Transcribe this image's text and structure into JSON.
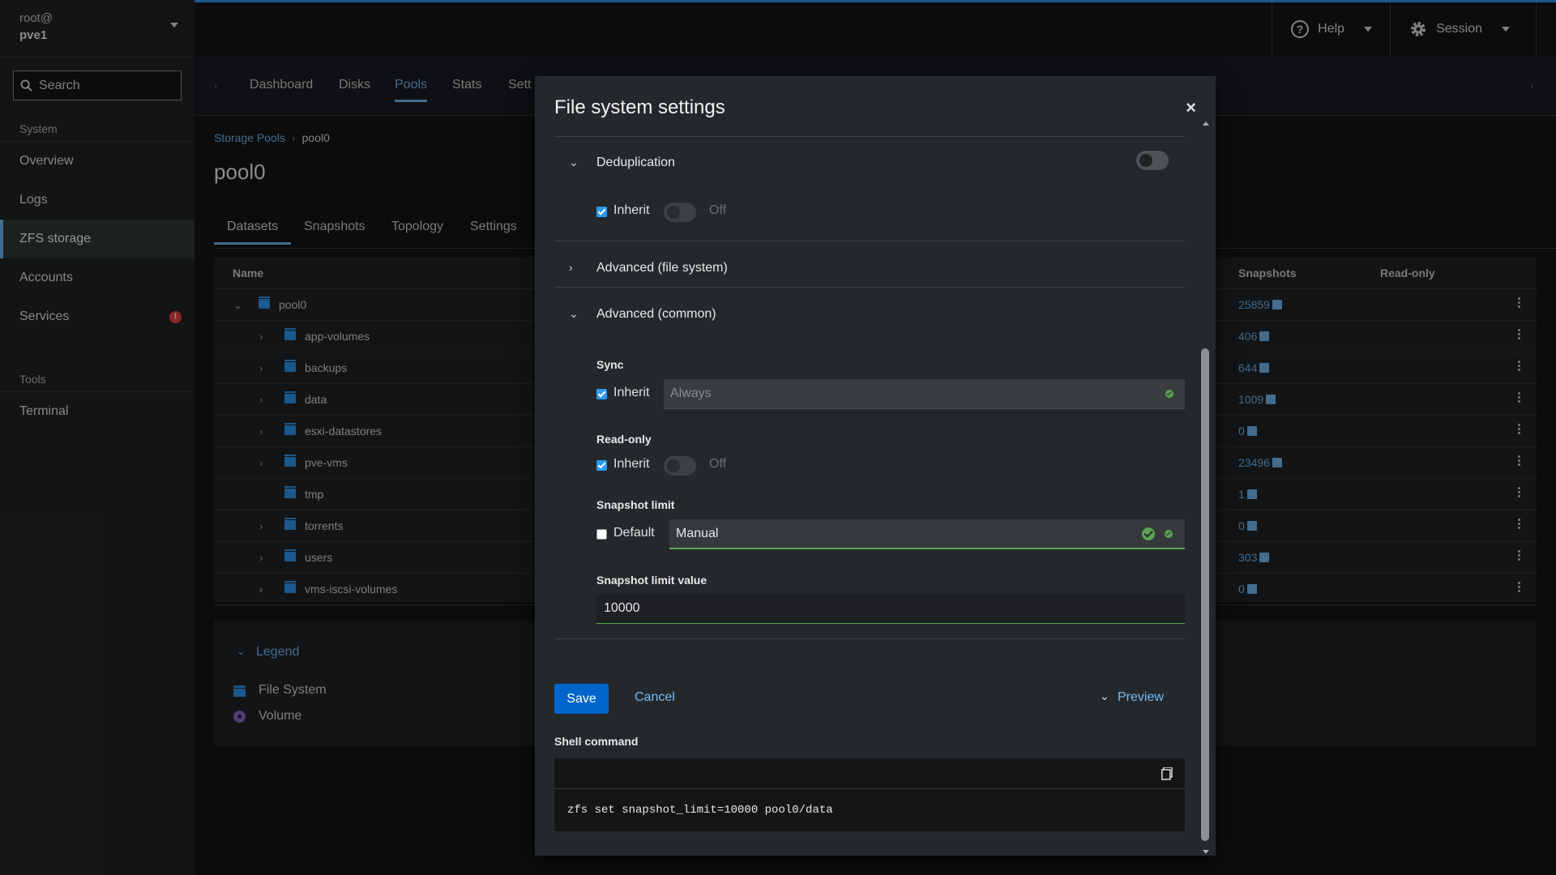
{
  "host": {
    "user": "root@",
    "name": "pve1"
  },
  "sidebar": {
    "search_placeholder": "Search",
    "system_heading": "System",
    "items": [
      {
        "label": "Overview"
      },
      {
        "label": "Logs"
      },
      {
        "label": "ZFS storage",
        "active": true
      },
      {
        "label": "Accounts"
      },
      {
        "label": "Services",
        "badge": "!"
      }
    ],
    "tools_heading": "Tools",
    "tools_items": [
      {
        "label": "Terminal"
      }
    ]
  },
  "topbar": {
    "help": "Help",
    "session": "Session"
  },
  "page": {
    "tabs": [
      "Dashboard",
      "Disks",
      "Pools",
      "Stats",
      "Sett"
    ],
    "active_tab": "Pools",
    "breadcrumb": {
      "parent": "Storage Pools",
      "current": "pool0"
    },
    "title": "pool0",
    "subtabs": [
      "Datasets",
      "Snapshots",
      "Topology",
      "Settings"
    ],
    "table": {
      "columns": {
        "name": "Name",
        "snapshots": "Snapshots",
        "readonly": "Read-only"
      },
      "rows": [
        {
          "name": "pool0",
          "snapshots": "25859",
          "expanded": true,
          "level": 0
        },
        {
          "name": "app-volumes",
          "snapshots": "406",
          "level": 1
        },
        {
          "name": "backups",
          "snapshots": "644",
          "level": 1
        },
        {
          "name": "data",
          "snapshots": "1009",
          "level": 1
        },
        {
          "name": "esxi-datastores",
          "snapshots": "0",
          "level": 1
        },
        {
          "name": "pve-vms",
          "snapshots": "23496",
          "level": 1
        },
        {
          "name": "tmp",
          "snapshots": "1",
          "level": 1,
          "no_children": true
        },
        {
          "name": "torrents",
          "snapshots": "0",
          "level": 1
        },
        {
          "name": "users",
          "snapshots": "303",
          "level": 1
        },
        {
          "name": "vms-iscsi-volumes",
          "snapshots": "0",
          "level": 1
        }
      ]
    },
    "legend": {
      "title": "Legend",
      "items": [
        "File System",
        "Volume"
      ]
    }
  },
  "modal": {
    "title": "File system settings",
    "dedup": {
      "label": "Deduplication",
      "inherit_label": "Inherit",
      "inherit_checked": true,
      "value": "Off"
    },
    "advanced_fs": {
      "label": "Advanced (file system)"
    },
    "advanced_common": {
      "label": "Advanced (common)",
      "sync": {
        "label": "Sync",
        "inherit_label": "Inherit",
        "inherit_checked": true,
        "value": "Always"
      },
      "readonly": {
        "label": "Read-only",
        "inherit_label": "Inherit",
        "inherit_checked": true,
        "value": "Off"
      },
      "snapshot_limit": {
        "label": "Snapshot limit",
        "default_label": "Default",
        "default_checked": false,
        "value": "Manual"
      },
      "snapshot_limit_value": {
        "label": "Snapshot limit value",
        "value": "10000"
      }
    },
    "buttons": {
      "save": "Save",
      "cancel": "Cancel",
      "preview": "Preview"
    },
    "shell": {
      "label": "Shell command",
      "command": "zfs set snapshot_limit=10000 pool0/data"
    }
  },
  "colors": {
    "accent": "#73bcf7",
    "primary_button": "#0066cc",
    "success": "#5ba352",
    "danger": "#ee4343"
  }
}
